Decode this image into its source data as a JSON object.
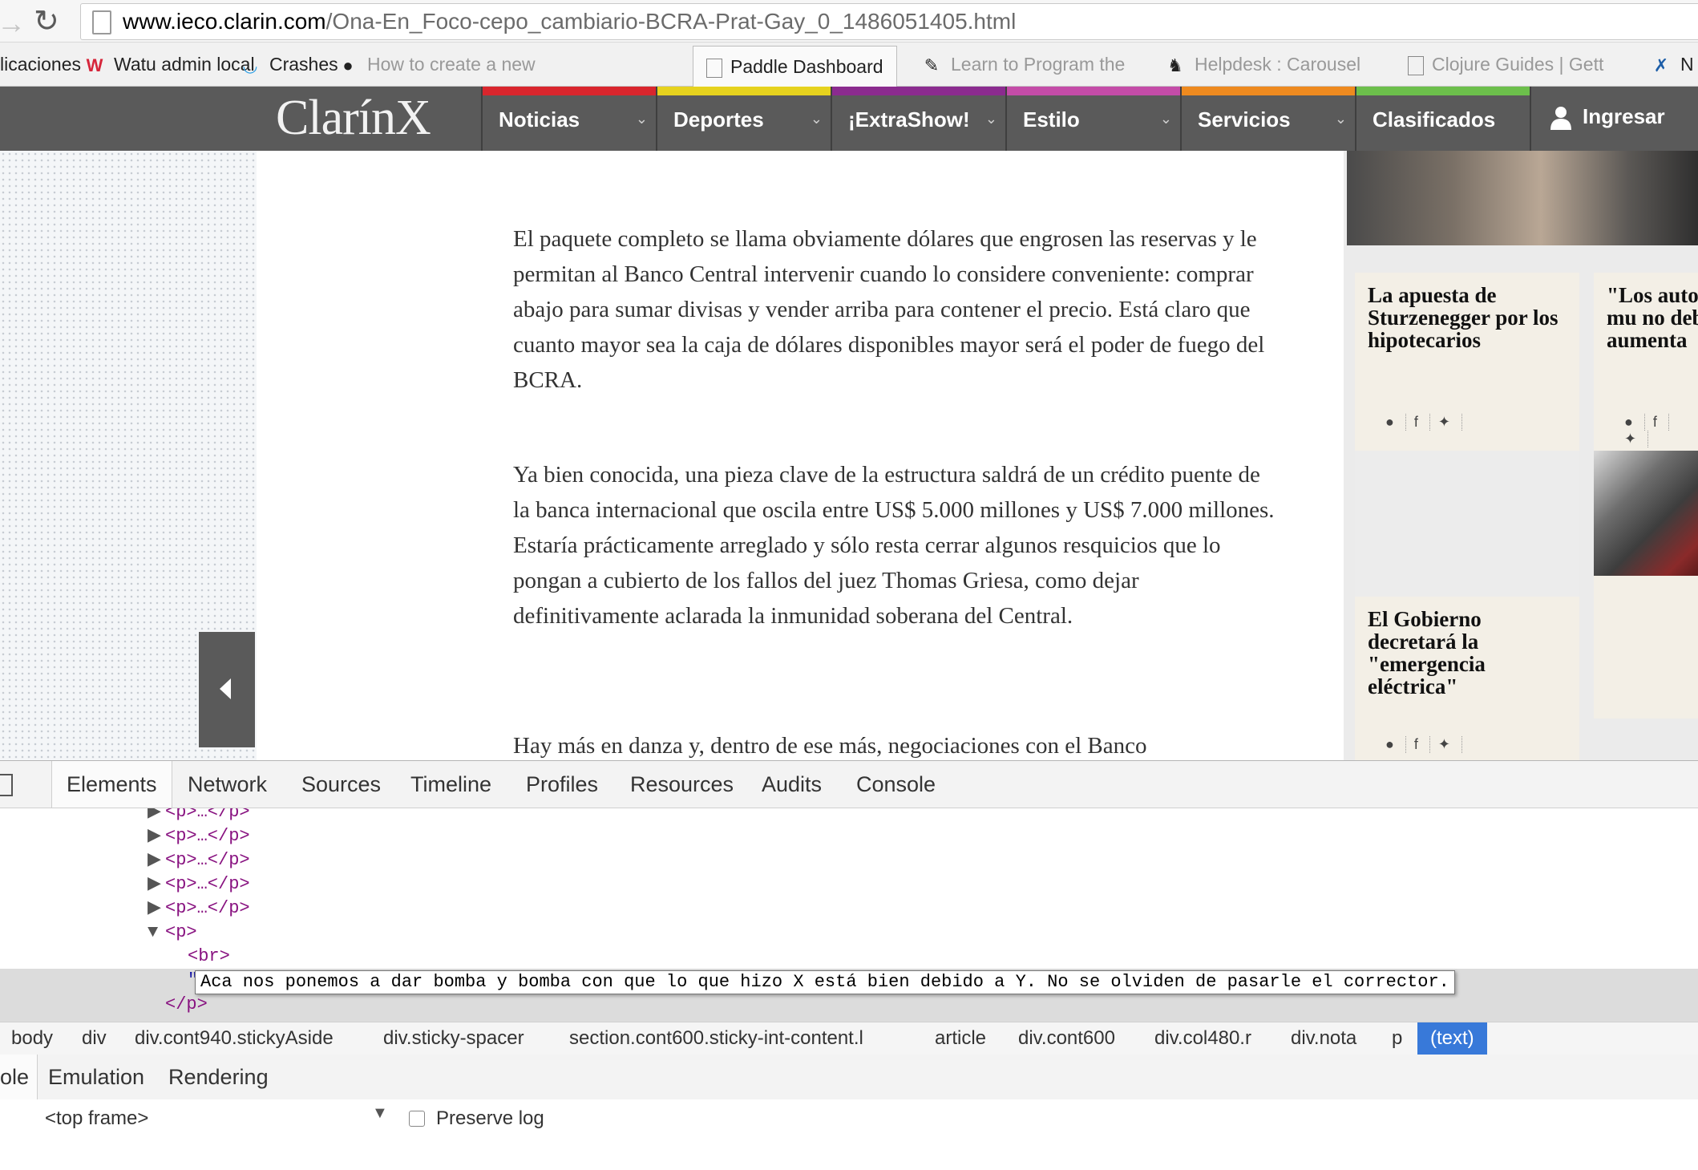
{
  "browser": {
    "url_host": "www.ieco.clarin.com",
    "url_path": "/Ona-En_Foco-cepo_cambiario-BCRA-Prat-Gay_0_1486051405.html",
    "bookmarks": [
      {
        "label": "licaciones",
        "icon": "apps-icon"
      },
      {
        "label": "Watu admin local",
        "icon": "watu-icon"
      },
      {
        "label": "Crashes",
        "icon": "crashes-icon"
      },
      {
        "label": "How to create a new",
        "icon": "github-icon"
      },
      {
        "label": "Paddle Dashboard",
        "icon": "page-icon"
      },
      {
        "label": "Learn to Program the",
        "icon": "learn-icon"
      },
      {
        "label": "Helpdesk : Carousel",
        "icon": "helpdesk-icon"
      },
      {
        "label": "Clojure Guides | Gett",
        "icon": "page-icon"
      },
      {
        "label": "N",
        "icon": "figure-icon"
      }
    ]
  },
  "clarin_nav": {
    "logo": "ClarínX",
    "items": [
      {
        "label": "Noticias",
        "color": "#d9262d"
      },
      {
        "label": "Deportes",
        "color": "#e6d21e"
      },
      {
        "label": "¡ExtraShow!",
        "color": "#8b2b8f"
      },
      {
        "label": "Estilo",
        "color": "#c44ca8"
      },
      {
        "label": "Servicios",
        "color": "#ee8a1f"
      },
      {
        "label": "Clasificados",
        "color": "#6cbf4b"
      }
    ],
    "login": "Ingresar"
  },
  "article": {
    "paragraphs": [
      "El paquete completo se llama obviamente dólares que engrosen las reservas y le permitan al Banco Central intervenir cuando lo considere conveniente: comprar abajo para sumar divisas y vender arriba para contener el precio. Está claro que cuanto mayor sea la caja de dólares disponibles mayor será el poder de fuego del BCRA.",
      "Ya bien conocida, una pieza clave de la estructura saldrá de un crédito puente de la banca internacional que oscila entre US$ 5.000 millones y US$ 7.000 millones. Estaría prácticamente arreglado y sólo resta cerrar algunos resquicios que lo pongan a cubierto de los fallos del juez Thomas Griesa, como dejar definitivamente aclarada la inmunidad soberana del Central.",
      "Hay más en danza y, dentro de ese más, negociaciones con el Banco"
    ]
  },
  "sidebar": {
    "cards": [
      {
        "title": "La apuesta de Sturzenegger por los hipotecarios"
      },
      {
        "title": "\"Los auto están mu no deben aumenta"
      },
      {
        "title": "El Gobierno decretará la \"emergencia eléctrica\""
      }
    ]
  },
  "devtools": {
    "tabs": [
      "Elements",
      "Network",
      "Sources",
      "Timeline",
      "Profiles",
      "Resources",
      "Audits",
      "Console"
    ],
    "active_tab": "Elements",
    "dom": {
      "collapsed_p": "<p>…</p>",
      "open_p": "<p>",
      "br": "<br>",
      "close_p": "</p>",
      "edited_text": "Aca nos ponemos a dar bomba y bomba con que lo que hizo X está bien debido a Y. No se olviden de pasarle el corrector."
    },
    "breadcrumbs": [
      "body",
      "div",
      "div.cont940.stickyAside",
      "div.sticky-spacer",
      "section.cont600.sticky-int-content.l",
      "article",
      "div.cont600",
      "div.col480.r",
      "div.nota",
      "p",
      "(text)"
    ],
    "drawer_tabs": [
      "ole",
      "Emulation",
      "Rendering"
    ],
    "console": {
      "frame": "<top frame>",
      "preserve_log": "Preserve log"
    }
  }
}
